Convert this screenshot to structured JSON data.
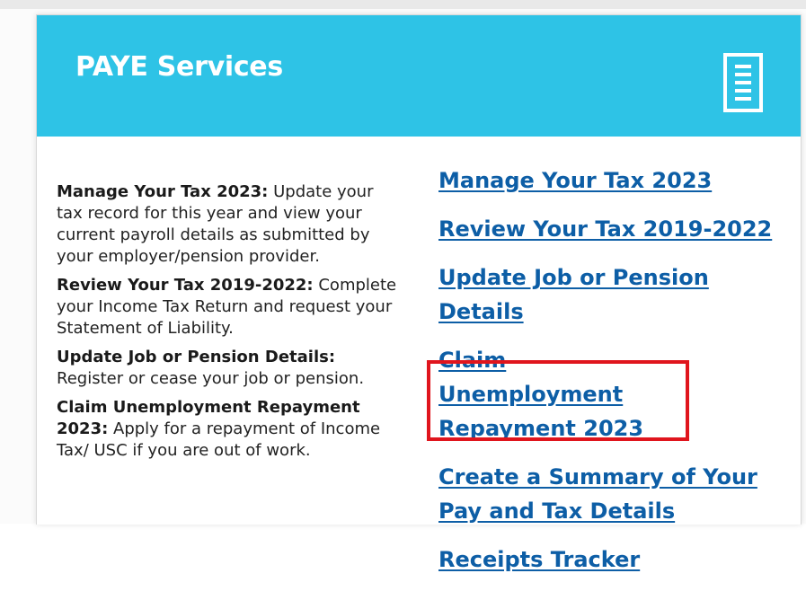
{
  "panel": {
    "title": "PAYE Services",
    "header_color": "#2ec3e6",
    "header_icon": "document-list-icon"
  },
  "descriptions": [
    {
      "term": "Manage Your Tax 2023:",
      "text": " Update your tax record for this year and view your current payroll details as submitted by your employer/pension provider."
    },
    {
      "term": "Review Your Tax 2019-2022:",
      "text": " Complete your Income Tax Return and request your Statement of Liability."
    },
    {
      "term": "Update Job or Pension Details:",
      "text": " Register or cease your job or pension."
    },
    {
      "term": "Claim Unemployment Repayment 2023:",
      "text": " Apply for a repayment of Income Tax/ USC if you are out of work."
    }
  ],
  "links": [
    {
      "label": "Manage Your Tax 2023"
    },
    {
      "label": "Review Your Tax 2019-2022"
    },
    {
      "label": "Update Job or Pension Details"
    },
    {
      "label": "Claim Unemployment Repayment 2023",
      "highlighted": true
    },
    {
      "label": "Create a Summary of Your Pay and Tax Details"
    },
    {
      "label": "Receipts Tracker"
    }
  ],
  "highlight_color": "#e0151d",
  "link_color": "#0d5ea6"
}
